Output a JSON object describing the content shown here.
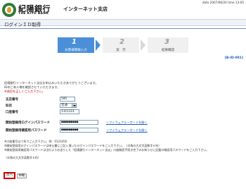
{
  "header": {
    "date_label": "date 2007/06/20 time 13:05",
    "bank_name": "紀陽銀行",
    "service_name": "インターネット支店",
    "bank_name_en": "THE KIYO BANK"
  },
  "page_title": "ログインＩＤ取得",
  "steps": [
    {
      "number": "1",
      "label": "お客様情報入力",
      "active": true
    },
    {
      "number": "2",
      "label": "実　行",
      "active": false
    },
    {
      "number": "3",
      "label": "結果確認",
      "active": false
    }
  ],
  "screen_id": "[B-ID-001]",
  "intro": {
    "line1": "紀陽銀行インターネット支店お申込みいただきありがとうございます。",
    "line2": "IDのご本人様を確認させていただきます。",
    "line3": "※項目を正しくご入力下さい。"
  },
  "form": {
    "branch_label": "支店番号",
    "branch_value": "595",
    "type_label": "科目",
    "type_value": "普通",
    "account_label": "口座番号",
    "account_value": "1111111",
    "login_pw_label": "開始登録用ログインパスワード",
    "login_pw_value": "●●●●●●●●●",
    "confirm_pw_label": "開始登録用確認用パスワード",
    "confirm_pw_value": "●●●●●●●●●",
    "software_keyboard_link": "ソフトウェアキーボードを開く"
  },
  "notes": {
    "line1": "※口座番号は７桁でご入力下さい。例：0123456",
    "line2": "※開始登録用ログインパスワードは申込書にご記入頂いたログインパスワードをご入力下さい。（半角の大文字英数字６桁）",
    "line3": "※開始登録用確認用パスワードは当行よりお送りした「紀陽銀行インターネット支店」口座開設手続き完了のお知らせに記載の確認用パスワードをご入力下さい。",
    "line4": "（半角の大文字英数字６桁）"
  },
  "buttons": {
    "next": "次へ",
    "cancel": "中断"
  },
  "colors": {
    "accent_blue": "#4a8fd8",
    "logo_green": "#2f7a3a",
    "highlight_red": "#d10000"
  }
}
